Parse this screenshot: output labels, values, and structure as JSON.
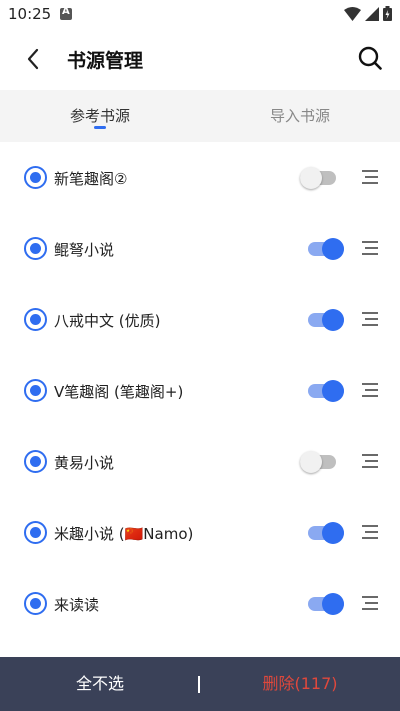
{
  "status": {
    "time": "10:25"
  },
  "header": {
    "title": "书源管理"
  },
  "tabs": [
    {
      "label": "参考书源",
      "active": true
    },
    {
      "label": "导入书源",
      "active": false
    }
  ],
  "sources": [
    {
      "name": "新笔趣阁②",
      "selected": true,
      "enabled": false
    },
    {
      "name": "鲲弩小说",
      "selected": true,
      "enabled": true
    },
    {
      "name": "八戒中文 (优质)",
      "selected": true,
      "enabled": true
    },
    {
      "name": "V笔趣阁 (笔趣阁+)",
      "selected": true,
      "enabled": true
    },
    {
      "name": "黄易小说",
      "selected": true,
      "enabled": false
    },
    {
      "name": "米趣小说 (🇨🇳Namo)",
      "selected": true,
      "enabled": true
    },
    {
      "name": "来读读",
      "selected": true,
      "enabled": true
    }
  ],
  "footer": {
    "deselect_all_label": "全不选",
    "delete_label": "删除(117)"
  },
  "colors": {
    "accent": "#2f6df0",
    "bottom_bar": "#3a4158",
    "delete_text": "#e0483c"
  },
  "icons": {
    "back": "chevron-left-icon",
    "search": "search-icon",
    "drag": "drag-handle-icon"
  }
}
